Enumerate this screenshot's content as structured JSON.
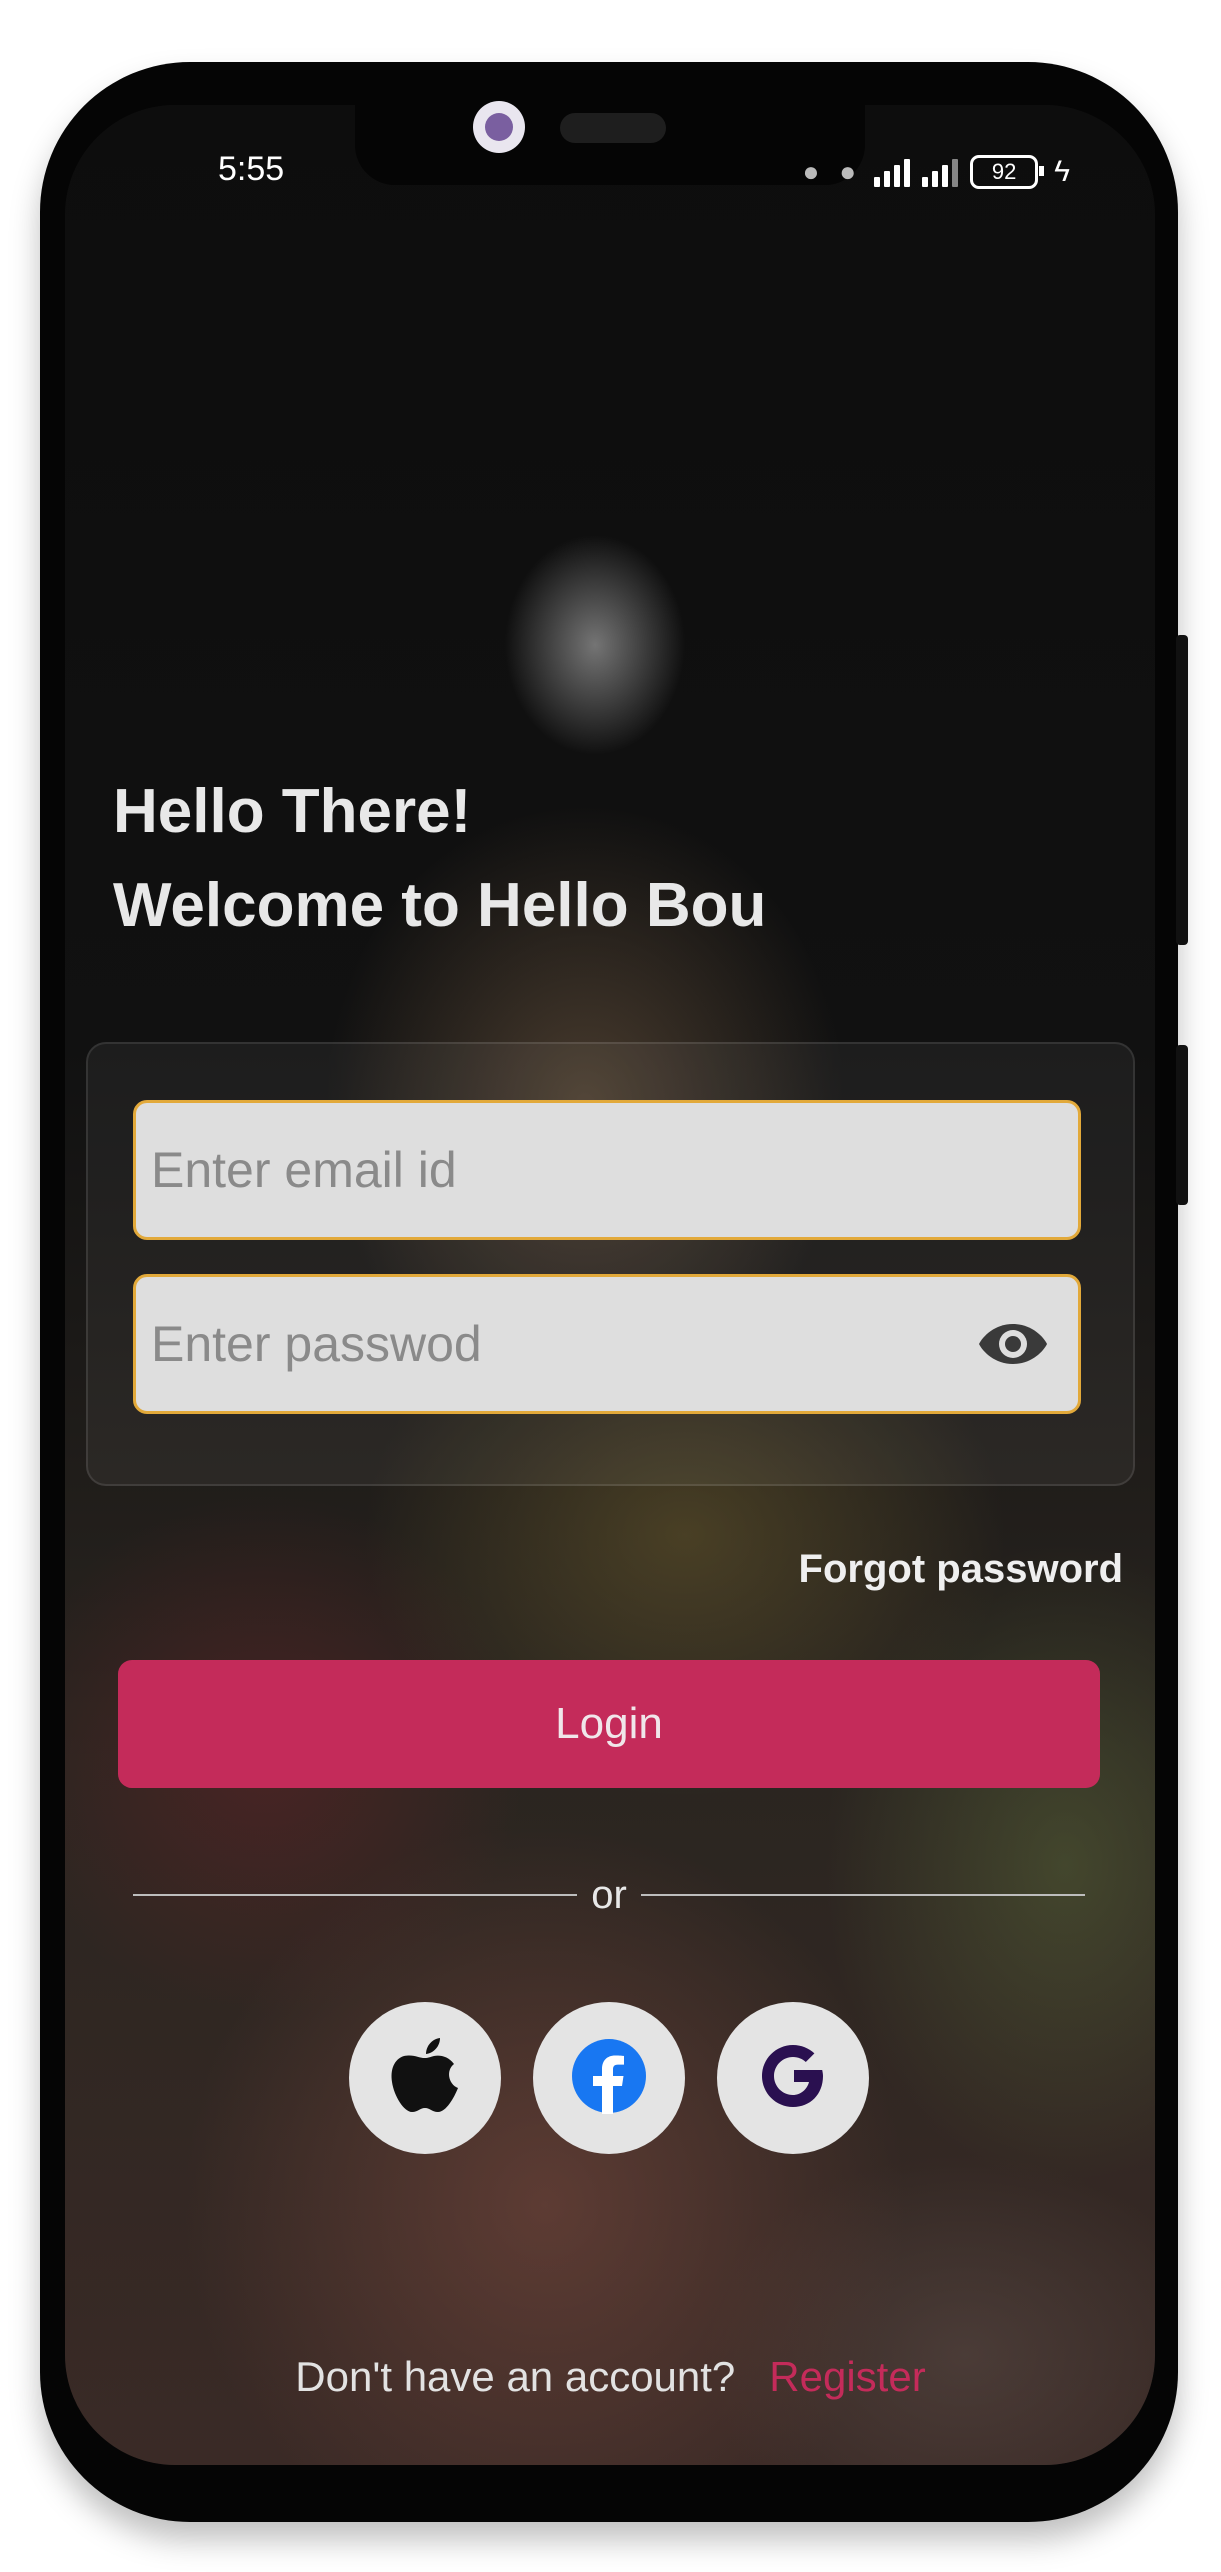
{
  "status_bar": {
    "time": "5:55",
    "battery": "92"
  },
  "greeting": {
    "line1": "Hello There!",
    "line2": "Welcome to Hello Bou"
  },
  "form": {
    "email_placeholder": "Enter email id",
    "email_value": "",
    "password_placeholder": "Enter passwod",
    "password_value": "",
    "eye_icon": "eye-icon"
  },
  "forgot_password": "Forgot password",
  "login_label": "Login",
  "divider_text": "or",
  "social": [
    {
      "name": "apple",
      "icon": "apple-icon"
    },
    {
      "name": "facebook",
      "icon": "facebook-icon"
    },
    {
      "name": "google",
      "icon": "google-icon"
    }
  ],
  "footer": {
    "prompt": "Don't have an account?",
    "register": "Register"
  },
  "colors": {
    "accent": "#c42b5a",
    "field_border": "#e2a93a",
    "field_bg": "#dedede",
    "facebook_blue": "#1877f2",
    "google_purple": "#2a1050"
  }
}
